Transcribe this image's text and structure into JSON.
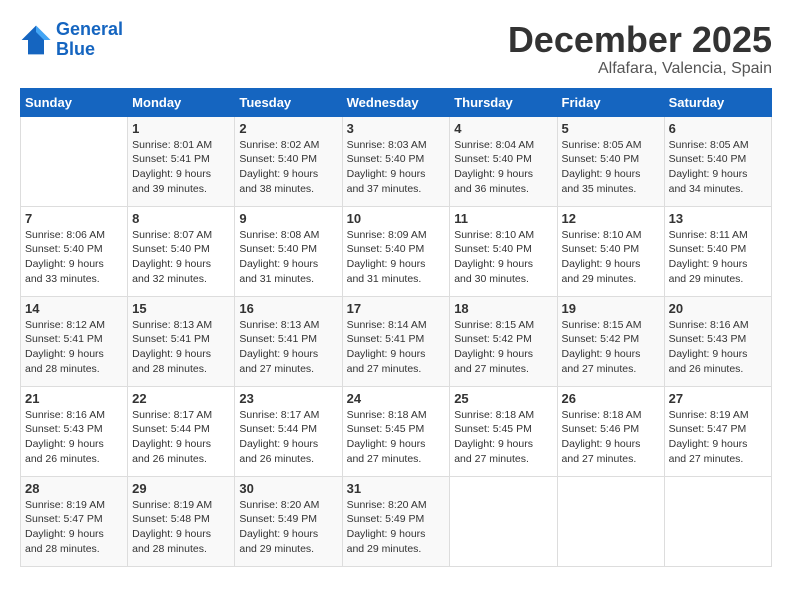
{
  "header": {
    "logo_line1": "General",
    "logo_line2": "Blue",
    "month": "December 2025",
    "location": "Alfafara, Valencia, Spain"
  },
  "days_of_week": [
    "Sunday",
    "Monday",
    "Tuesday",
    "Wednesday",
    "Thursday",
    "Friday",
    "Saturday"
  ],
  "weeks": [
    [
      {
        "day": "",
        "sunrise": "",
        "sunset": "",
        "daylight": ""
      },
      {
        "day": "1",
        "sunrise": "Sunrise: 8:01 AM",
        "sunset": "Sunset: 5:41 PM",
        "daylight": "Daylight: 9 hours and 39 minutes."
      },
      {
        "day": "2",
        "sunrise": "Sunrise: 8:02 AM",
        "sunset": "Sunset: 5:40 PM",
        "daylight": "Daylight: 9 hours and 38 minutes."
      },
      {
        "day": "3",
        "sunrise": "Sunrise: 8:03 AM",
        "sunset": "Sunset: 5:40 PM",
        "daylight": "Daylight: 9 hours and 37 minutes."
      },
      {
        "day": "4",
        "sunrise": "Sunrise: 8:04 AM",
        "sunset": "Sunset: 5:40 PM",
        "daylight": "Daylight: 9 hours and 36 minutes."
      },
      {
        "day": "5",
        "sunrise": "Sunrise: 8:05 AM",
        "sunset": "Sunset: 5:40 PM",
        "daylight": "Daylight: 9 hours and 35 minutes."
      },
      {
        "day": "6",
        "sunrise": "Sunrise: 8:05 AM",
        "sunset": "Sunset: 5:40 PM",
        "daylight": "Daylight: 9 hours and 34 minutes."
      }
    ],
    [
      {
        "day": "7",
        "sunrise": "Sunrise: 8:06 AM",
        "sunset": "Sunset: 5:40 PM",
        "daylight": "Daylight: 9 hours and 33 minutes."
      },
      {
        "day": "8",
        "sunrise": "Sunrise: 8:07 AM",
        "sunset": "Sunset: 5:40 PM",
        "daylight": "Daylight: 9 hours and 32 minutes."
      },
      {
        "day": "9",
        "sunrise": "Sunrise: 8:08 AM",
        "sunset": "Sunset: 5:40 PM",
        "daylight": "Daylight: 9 hours and 31 minutes."
      },
      {
        "day": "10",
        "sunrise": "Sunrise: 8:09 AM",
        "sunset": "Sunset: 5:40 PM",
        "daylight": "Daylight: 9 hours and 31 minutes."
      },
      {
        "day": "11",
        "sunrise": "Sunrise: 8:10 AM",
        "sunset": "Sunset: 5:40 PM",
        "daylight": "Daylight: 9 hours and 30 minutes."
      },
      {
        "day": "12",
        "sunrise": "Sunrise: 8:10 AM",
        "sunset": "Sunset: 5:40 PM",
        "daylight": "Daylight: 9 hours and 29 minutes."
      },
      {
        "day": "13",
        "sunrise": "Sunrise: 8:11 AM",
        "sunset": "Sunset: 5:40 PM",
        "daylight": "Daylight: 9 hours and 29 minutes."
      }
    ],
    [
      {
        "day": "14",
        "sunrise": "Sunrise: 8:12 AM",
        "sunset": "Sunset: 5:41 PM",
        "daylight": "Daylight: 9 hours and 28 minutes."
      },
      {
        "day": "15",
        "sunrise": "Sunrise: 8:13 AM",
        "sunset": "Sunset: 5:41 PM",
        "daylight": "Daylight: 9 hours and 28 minutes."
      },
      {
        "day": "16",
        "sunrise": "Sunrise: 8:13 AM",
        "sunset": "Sunset: 5:41 PM",
        "daylight": "Daylight: 9 hours and 27 minutes."
      },
      {
        "day": "17",
        "sunrise": "Sunrise: 8:14 AM",
        "sunset": "Sunset: 5:41 PM",
        "daylight": "Daylight: 9 hours and 27 minutes."
      },
      {
        "day": "18",
        "sunrise": "Sunrise: 8:15 AM",
        "sunset": "Sunset: 5:42 PM",
        "daylight": "Daylight: 9 hours and 27 minutes."
      },
      {
        "day": "19",
        "sunrise": "Sunrise: 8:15 AM",
        "sunset": "Sunset: 5:42 PM",
        "daylight": "Daylight: 9 hours and 27 minutes."
      },
      {
        "day": "20",
        "sunrise": "Sunrise: 8:16 AM",
        "sunset": "Sunset: 5:43 PM",
        "daylight": "Daylight: 9 hours and 26 minutes."
      }
    ],
    [
      {
        "day": "21",
        "sunrise": "Sunrise: 8:16 AM",
        "sunset": "Sunset: 5:43 PM",
        "daylight": "Daylight: 9 hours and 26 minutes."
      },
      {
        "day": "22",
        "sunrise": "Sunrise: 8:17 AM",
        "sunset": "Sunset: 5:44 PM",
        "daylight": "Daylight: 9 hours and 26 minutes."
      },
      {
        "day": "23",
        "sunrise": "Sunrise: 8:17 AM",
        "sunset": "Sunset: 5:44 PM",
        "daylight": "Daylight: 9 hours and 26 minutes."
      },
      {
        "day": "24",
        "sunrise": "Sunrise: 8:18 AM",
        "sunset": "Sunset: 5:45 PM",
        "daylight": "Daylight: 9 hours and 27 minutes."
      },
      {
        "day": "25",
        "sunrise": "Sunrise: 8:18 AM",
        "sunset": "Sunset: 5:45 PM",
        "daylight": "Daylight: 9 hours and 27 minutes."
      },
      {
        "day": "26",
        "sunrise": "Sunrise: 8:18 AM",
        "sunset": "Sunset: 5:46 PM",
        "daylight": "Daylight: 9 hours and 27 minutes."
      },
      {
        "day": "27",
        "sunrise": "Sunrise: 8:19 AM",
        "sunset": "Sunset: 5:47 PM",
        "daylight": "Daylight: 9 hours and 27 minutes."
      }
    ],
    [
      {
        "day": "28",
        "sunrise": "Sunrise: 8:19 AM",
        "sunset": "Sunset: 5:47 PM",
        "daylight": "Daylight: 9 hours and 28 minutes."
      },
      {
        "day": "29",
        "sunrise": "Sunrise: 8:19 AM",
        "sunset": "Sunset: 5:48 PM",
        "daylight": "Daylight: 9 hours and 28 minutes."
      },
      {
        "day": "30",
        "sunrise": "Sunrise: 8:20 AM",
        "sunset": "Sunset: 5:49 PM",
        "daylight": "Daylight: 9 hours and 29 minutes."
      },
      {
        "day": "31",
        "sunrise": "Sunrise: 8:20 AM",
        "sunset": "Sunset: 5:49 PM",
        "daylight": "Daylight: 9 hours and 29 minutes."
      },
      {
        "day": "",
        "sunrise": "",
        "sunset": "",
        "daylight": ""
      },
      {
        "day": "",
        "sunrise": "",
        "sunset": "",
        "daylight": ""
      },
      {
        "day": "",
        "sunrise": "",
        "sunset": "",
        "daylight": ""
      }
    ]
  ]
}
